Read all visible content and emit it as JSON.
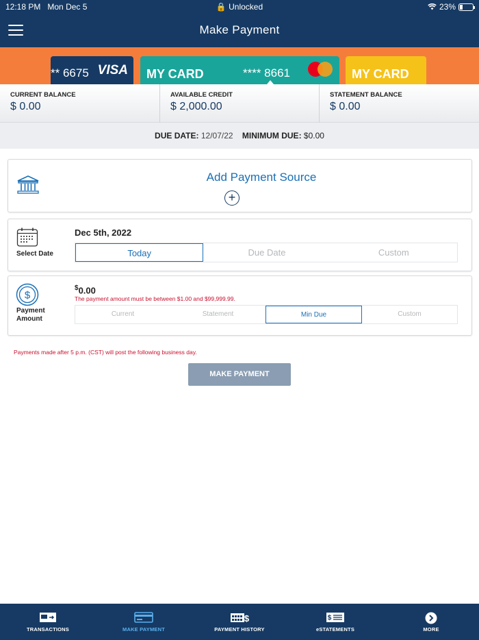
{
  "status": {
    "time": "12:18 PM",
    "date": "Mon Dec 5",
    "lock_label": "Unlocked",
    "battery": "23%",
    "battery_level": 0.23
  },
  "header": {
    "title": "Make Payment"
  },
  "cards": {
    "visa": {
      "number": "** 6675",
      "brand": "VISA"
    },
    "selected": {
      "name": "MY CARD",
      "number": "**** 8661"
    },
    "next": {
      "name": "MY CARD"
    }
  },
  "balances": {
    "current_label": "CURRENT BALANCE",
    "current_value": "$ 0.00",
    "available_label": "AVAILABLE CREDIT",
    "available_value": "$ 2,000.00",
    "statement_label": "STATEMENT BALANCE",
    "statement_value": "$ 0.00"
  },
  "due": {
    "date_label": "DUE DATE:",
    "date_value": "12/07/22",
    "min_label": "MINIMUM DUE:",
    "min_value": "$0.00"
  },
  "source": {
    "add_label": "Add Payment Source",
    "plus": "+"
  },
  "date": {
    "side_label": "Select Date",
    "value": "Dec 5th, 2022",
    "options": [
      "Today",
      "Due Date",
      "Custom"
    ],
    "selected": "Today"
  },
  "amount": {
    "side_label_1": "Payment",
    "side_label_2": "Amount",
    "currency": "$",
    "value": "0.00",
    "error": "The payment amount must be between $1.00 and $99,999.99.",
    "options": [
      "Current",
      "Statement",
      "Min Due",
      "Custom"
    ],
    "selected": "Min Due"
  },
  "note": "Payments made after 5 p.m. (CST) will post the following business day.",
  "pay_button": "MAKE PAYMENT",
  "nav": {
    "items": [
      {
        "label": "TRANSACTIONS",
        "icon": "transactions-icon"
      },
      {
        "label": "MAKE PAYMENT",
        "icon": "card-icon"
      },
      {
        "label": "PAYMENT HISTORY",
        "icon": "calendar-dollar-icon"
      },
      {
        "label": "eSTATEMENTS",
        "icon": "statement-icon"
      },
      {
        "label": "MORE",
        "icon": "chevron-right-circle-icon"
      }
    ],
    "active": "MAKE PAYMENT"
  },
  "colors": {
    "navy": "#163a63",
    "orange": "#f47d3c",
    "teal": "#1aa59a",
    "yellow": "#f5c21a",
    "link_blue": "#1a6fb5",
    "error_red": "#c8102e",
    "button_gray": "#8a9db2"
  }
}
